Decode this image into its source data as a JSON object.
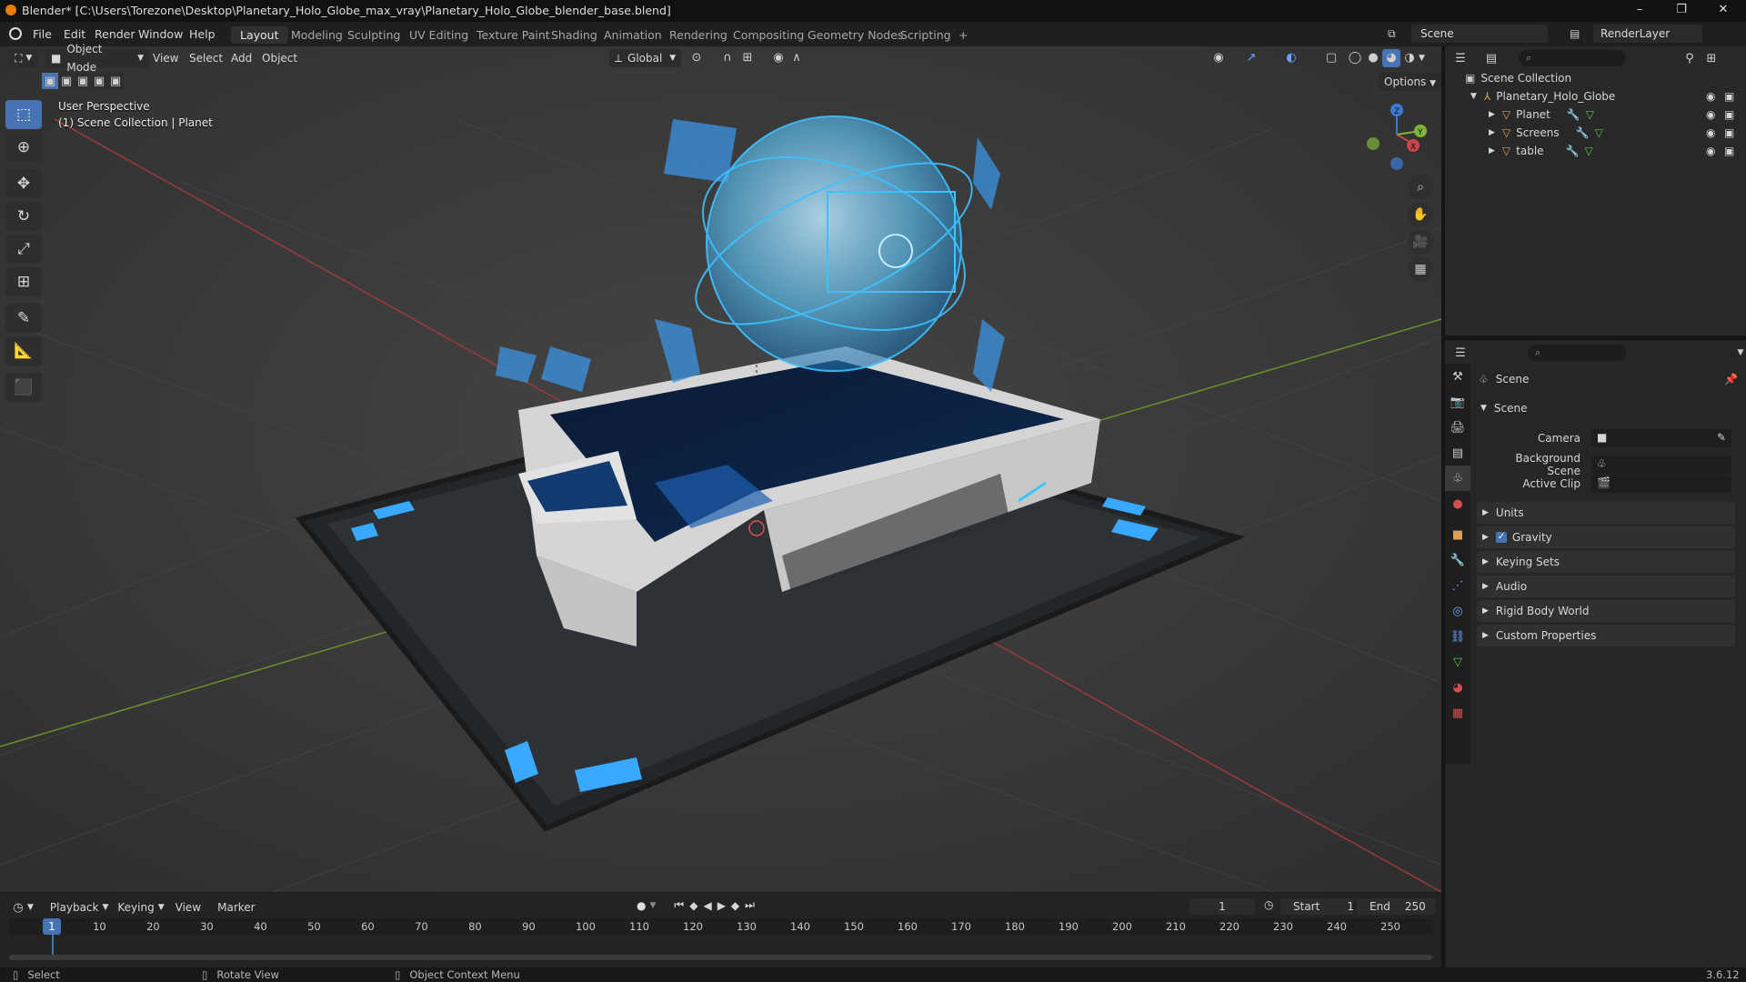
{
  "titlebar": {
    "title": "Blender* [C:\\Users\\Torezone\\Desktop\\Planetary_Holo_Globe_max_vray\\Planetary_Holo_Globe_blender_base.blend]",
    "minimize": "–",
    "maximize": "❐",
    "close": "✕"
  },
  "menus": [
    "File",
    "Edit",
    "Render",
    "Window",
    "Help"
  ],
  "workspaces": [
    "Layout",
    "Modeling",
    "Sculpting",
    "UV Editing",
    "Texture Paint",
    "Shading",
    "Animation",
    "Rendering",
    "Compositing",
    "Geometry Nodes",
    "Scripting"
  ],
  "workspace_add": "+",
  "top_right": {
    "scene": "Scene",
    "render_layer": "RenderLayer"
  },
  "viewport_header": {
    "mode": "Object Mode",
    "menus": [
      "View",
      "Select",
      "Add",
      "Object"
    ],
    "orientation": "Global",
    "options": "Options"
  },
  "viewport": {
    "perspective": "User Perspective",
    "collection": "(1) Scene Collection | Planet",
    "gizmo_axes": [
      "X",
      "Y",
      "Z"
    ]
  },
  "outliner": {
    "root": "Scene Collection",
    "items": [
      {
        "name": "Planetary_Holo_Globe",
        "level": 1
      },
      {
        "name": "Planet",
        "level": 2
      },
      {
        "name": "Screens",
        "level": 2
      },
      {
        "name": "table",
        "level": 2
      }
    ]
  },
  "properties": {
    "header": "Scene",
    "section": "Scene",
    "fields": [
      {
        "label": "Camera",
        "value": ""
      },
      {
        "label": "Background Scene",
        "value": ""
      },
      {
        "label": "Active Clip",
        "value": ""
      }
    ],
    "panels": [
      "Units",
      "Gravity",
      "Keying Sets",
      "Audio",
      "Rigid Body World",
      "Custom Properties"
    ],
    "gravity_checked": true
  },
  "timeline": {
    "menus": [
      "Playback",
      "Keying",
      "View",
      "Marker"
    ],
    "current_frame": "1",
    "start_label": "Start",
    "start": "1",
    "end_label": "End",
    "end": "250",
    "ticks": [
      "1",
      "10",
      "20",
      "30",
      "40",
      "50",
      "60",
      "70",
      "80",
      "90",
      "100",
      "110",
      "120",
      "130",
      "140",
      "150",
      "160",
      "170",
      "180",
      "190",
      "200",
      "210",
      "220",
      "230",
      "240",
      "250"
    ]
  },
  "statusbar": {
    "select": "Select",
    "rotate": "Rotate View",
    "context": "Object Context Menu",
    "version": "3.6.12"
  },
  "colors": {
    "accent": "#4772b3",
    "holo": "#3fc1ff",
    "axis_x": "#c8464b",
    "axis_y": "#7fb53a",
    "axis_z": "#3a7bd5"
  }
}
